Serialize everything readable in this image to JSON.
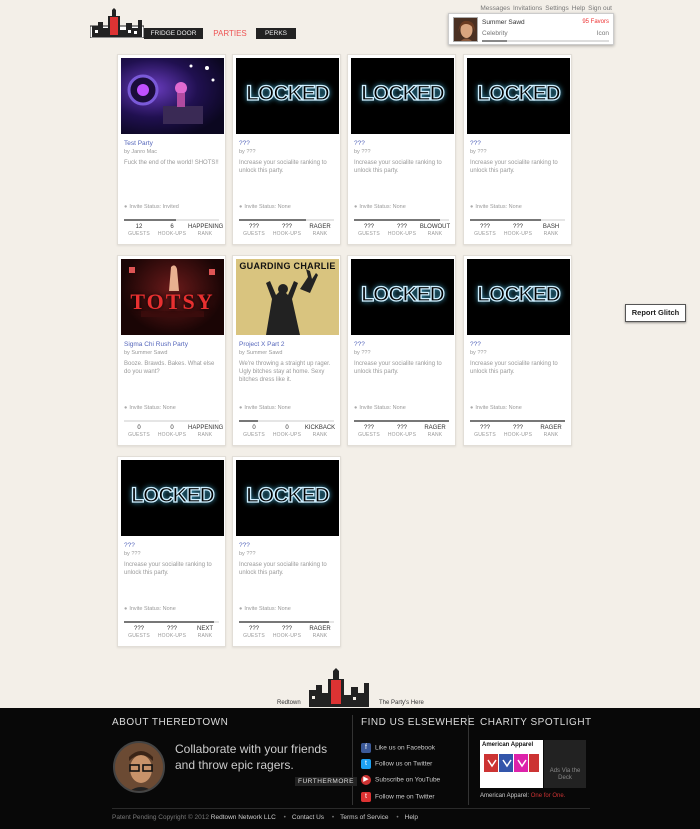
{
  "top_links": [
    "Messages",
    "Invitations",
    "Settings",
    "Help",
    "Sign out"
  ],
  "nav": {
    "fridge_door": "FRIDGE DOOR",
    "parties": "PARTIES",
    "perks": "PERKS"
  },
  "user": {
    "name": "Summer Sawd",
    "favors": "95 Favors",
    "role": "Celebrity",
    "rank": "Icon",
    "progress": 0.2
  },
  "report_glitch": "Report Glitch",
  "stat_labels": {
    "guests": "GUESTS",
    "hookups": "HOOK-UPS",
    "rank": "RANK"
  },
  "cards": [
    {
      "title": "Test Party",
      "by": "by Janro Mac",
      "desc": "Fuck the end of the world! SHOTS!!",
      "invite": "Invite Status: Invited",
      "guests": "12",
      "hookups": "6",
      "rank": "HAPPENING",
      "progress": 0.55,
      "image": "party-photo"
    },
    {
      "title": "???",
      "by": "by ???",
      "desc": "Increase your socialite ranking to unlock this party.",
      "invite": "Invite Status: None",
      "guests": "???",
      "hookups": "???",
      "rank": "RAGER",
      "progress": 0.7,
      "image": "LOCKED"
    },
    {
      "title": "???",
      "by": "by ???",
      "desc": "Increase your socialite ranking to unlock this party.",
      "invite": "Invite Status: None",
      "guests": "???",
      "hookups": "???",
      "rank": "BLOWOUT",
      "progress": 0.9,
      "image": "LOCKED"
    },
    {
      "title": "???",
      "by": "by ???",
      "desc": "Increase your socialite ranking to unlock this party.",
      "invite": "Invite Status: None",
      "guests": "???",
      "hookups": "???",
      "rank": "BASH",
      "progress": 0.75,
      "image": "LOCKED"
    },
    {
      "title": "Sigma Chi Rush Party",
      "by": "by Summer Sawd",
      "desc": "Booze. Brawds. Bakes. What else do you want?",
      "invite": "Invite Status: None",
      "guests": "0",
      "hookups": "0",
      "rank": "HAPPENING",
      "progress": 0.0,
      "image": "TOTSY"
    },
    {
      "title": "Project X Part 2",
      "by": "by Summer Sawd",
      "desc": "We're throwing a straight up rager. Ugly bitches stay at home. Sexy bitches dress like it.",
      "invite": "Invite Status: None",
      "guests": "0",
      "hookups": "0",
      "rank": "KICKBACK",
      "progress": 0.2,
      "image": "GUARDING CHARLIE"
    },
    {
      "title": "???",
      "by": "by ???",
      "desc": "Increase your socialite ranking to unlock this party.",
      "invite": "Invite Status: None",
      "guests": "???",
      "hookups": "???",
      "rank": "RAGER",
      "progress": 1.0,
      "image": "LOCKED"
    },
    {
      "title": "???",
      "by": "by ???",
      "desc": "Increase your socialite ranking to unlock this party.",
      "invite": "Invite Status: None",
      "guests": "???",
      "hookups": "???",
      "rank": "RAGER",
      "progress": 1.0,
      "image": "LOCKED"
    },
    {
      "title": "???",
      "by": "by ???",
      "desc": "Increase your socialite ranking to unlock this party.",
      "invite": "Invite Status: None",
      "guests": "???",
      "hookups": "???",
      "rank": "NEXT",
      "progress": 0.95,
      "image": "LOCKED"
    },
    {
      "title": "???",
      "by": "by ???",
      "desc": "Increase your socialite ranking to unlock this party.",
      "invite": "Invite Status: None",
      "guests": "???",
      "hookups": "???",
      "rank": "RAGER",
      "progress": 0.95,
      "image": "LOCKED"
    }
  ],
  "locked_text": "LOCKED",
  "totsy_text": "TOTSY",
  "guarding_text": "GUARDING CHARLIE",
  "brand_left": "Redtown",
  "brand_right": "The Party's Here",
  "about": {
    "heading": "ABOUT THEREDTOWN",
    "text": "Collaborate with your friends and throw epic ragers.",
    "button": "FURTHERMORE"
  },
  "find": {
    "heading": "FIND US ELSEWHERE",
    "links": [
      "Like us on Facebook",
      "Follow us on Twitter",
      "Subscribe on YouTube",
      "Follow me on Twitter"
    ]
  },
  "charity": {
    "heading": "CHARITY SPOTLIGHT",
    "brand": "American Apparel",
    "ads": "Ads Via the Deck",
    "caption_name": "American Apparel:",
    "caption_link": "One for One."
  },
  "copyright": {
    "text": "Patent Pending Copyright © 2012",
    "company": "Redtown Network LLC",
    "links": [
      "Contact Us",
      "Terms of Service",
      "Help"
    ]
  }
}
